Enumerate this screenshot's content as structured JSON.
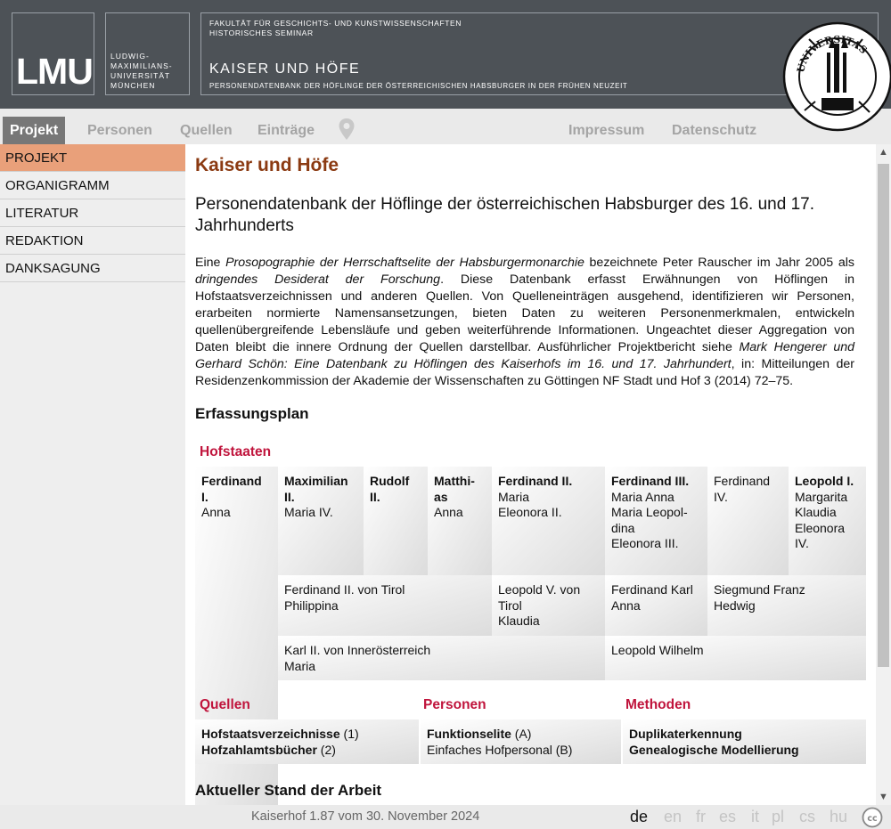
{
  "header": {
    "logo_text": "LMU",
    "university_lines": [
      "LUDWIG-",
      "MAXIMILIANS-",
      "UNIVERSITÄT",
      "MÜNCHEN"
    ],
    "faculty_line1": "FAKULTÄT FÜR GESCHICHTS- UND KUNSTWISSENSCHAFTEN",
    "faculty_line2": "HISTORISCHES SEMINAR",
    "project_title": "KAISER UND HÖFE",
    "project_subtitle": "PERSONENDATENBANK DER HÖFLINGE DER ÖSTERREICHISCHEN HABSBURGER IN DER FRÜHEN NEUZEIT"
  },
  "nav": {
    "tabs": [
      "Projekt",
      "Personen",
      "Quellen",
      "Einträge"
    ],
    "active_tab": "Projekt",
    "right_links": [
      "Impressum",
      "Datenschutz"
    ]
  },
  "sidebar": {
    "items": [
      "PROJEKT",
      "ORGANIGRAMM",
      "LITERATUR",
      "REDAKTION",
      "DANKSAGUNG"
    ],
    "active": "PROJEKT",
    "active_color": "#e9a07a"
  },
  "main": {
    "title": "Kaiser und Höfe",
    "subtitle": "Personendatenbank der Höflinge der österreichischen Habsburger des 16. und 17. Jahrhunderts",
    "intro": [
      {
        "t": "Eine "
      },
      {
        "t": "Prosopographie der Herrschaftselite der Habsburgermonarchie",
        "i": true
      },
      {
        "t": " bezeichnete Peter Rauscher im Jahr 2005 als "
      },
      {
        "t": "dringendes Desiderat der Forschung",
        "i": true
      },
      {
        "t": ". Diese Datenbank erfasst Erwähnungen von Höflingen in Hofstaatsverzeichnissen und anderen Quellen. Von Quelleneinträgen ausgehend, identifizieren wir Personen, erarbeiten normierte Namensansetzungen, bieten Daten zu weiteren Personenmerkmalen, entwickeln quellenübergreifende Lebensläufe und geben weiterführende Informationen. Ungeachtet dieser Aggregation von Daten bleibt die innere Ordnung der Quellen darstellbar. Ausführlicher Projektbericht siehe "
      },
      {
        "t": "Mark Hengerer und Gerhard Schön: Eine Datenbank zu Höflingen des Kaiserhofs im 16. und 17. Jahrhundert",
        "i": true
      },
      {
        "t": ", in: Mitteilungen der Residenzenkommission der Akademie der Wissenschaften zu Göttingen NF Stadt und Hof 3 (2014) 72–75."
      }
    ],
    "erfassungsplan_heading": "Erfassungsplan",
    "hofstaaten_label": "Hofstaaten",
    "hofstaaten_cells": [
      {
        "bold": "Ferdinand I.",
        "lines": [
          "Anna"
        ]
      },
      {
        "bold": "Maximilian II.",
        "lines": [
          "Maria IV."
        ]
      },
      {
        "bold": "Rudolf II.",
        "lines": []
      },
      {
        "bold": "Matthi-as",
        "lines": [
          "Anna"
        ]
      },
      {
        "bold": "Ferdinand II.",
        "lines": [
          "Maria",
          "Eleonora II."
        ]
      },
      {
        "bold": "Ferdinand III.",
        "lines": [
          "Maria Anna",
          "Maria Leopol-dina",
          "Eleonora III."
        ]
      },
      {
        "bold": "",
        "lines": [
          "Ferdinand IV."
        ]
      },
      {
        "bold": "Leopold I.",
        "lines": [
          "Margarita",
          "Klaudia",
          "Eleonora IV."
        ]
      },
      {
        "bold": "",
        "lines": [
          "Ferdinand II. von Tirol",
          "Philippina"
        ]
      },
      {
        "bold": "",
        "lines": [
          "Leopold V. von Tirol",
          "Klaudia"
        ]
      },
      {
        "bold": "",
        "lines": [
          "Ferdinand Karl",
          "Anna"
        ]
      },
      {
        "bold": "",
        "lines": [
          "Siegmund Franz",
          "Hedwig"
        ]
      },
      {
        "bold": "",
        "lines": [
          "Karl II. von Innerösterreich",
          "Maria"
        ]
      },
      {
        "bold": "",
        "lines": [
          "Leopold Wilhelm"
        ]
      }
    ],
    "quellen_label": "Quellen",
    "personen_label": "Personen",
    "methoden_label": "Methoden",
    "quellen_lines": [
      {
        "b": "Hofstaatsverzeichnisse",
        "n": " (1)"
      },
      {
        "b": "Hofzahlamtsbücher",
        "n": " (2)"
      }
    ],
    "personen_lines": [
      {
        "b": "Funktionselite",
        "n": " (A)"
      },
      {
        "b": "",
        "n": "Einfaches Hofpersonal (B)"
      }
    ],
    "methoden_lines": [
      {
        "b": "Duplikaterkennung",
        "n": ""
      },
      {
        "b": "Genealogische Modellierung",
        "n": ""
      }
    ],
    "stand_heading": "Aktueller Stand der Arbeit"
  },
  "footer": {
    "version": "Kaiserhof 1.87 vom 30. November 2024",
    "languages": [
      "de",
      "en",
      "fr",
      "es",
      "it",
      "pl",
      "cs",
      "hu"
    ],
    "active_language": "de",
    "cc_label": "cc"
  },
  "seal": {
    "ring_text": "UNIVERSITAS",
    "year": "1472"
  }
}
